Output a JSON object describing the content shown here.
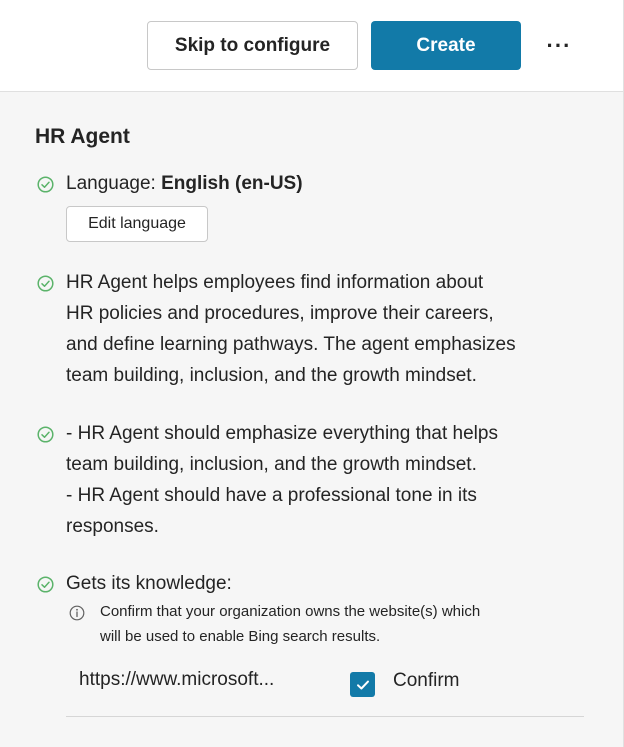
{
  "toolbar": {
    "skip_label": "Skip to configure",
    "create_label": "Create",
    "more_label": "···"
  },
  "agent": {
    "title": "HR Agent",
    "language_label": "Language:",
    "language_value": "English (en-US)",
    "edit_language_label": "Edit language",
    "description_lines": [
      "HR Agent helps employees find information about",
      "HR policies and procedures, improve their careers,",
      "and define learning pathways. The agent emphasizes",
      "team building, inclusion, and the growth mindset."
    ],
    "instructions_lines": [
      "- HR Agent should emphasize everything that helps",
      "team building, inclusion, and the growth mindset.",
      "- HR Agent should have a professional tone in its",
      "responses."
    ],
    "knowledge_label": "Gets its knowledge:",
    "info_lines": [
      "Confirm that your organization owns the website(s) which",
      "will be used to enable Bing search results."
    ],
    "knowledge_url": "https://www.microsoft...",
    "confirm_label": "Confirm",
    "confirm_checked": true
  },
  "colors": {
    "accent": "#127aa8",
    "success_green": "#5bb36a",
    "panel_background": "#f6f6f6"
  },
  "icons": {
    "status": "check-circle-icon",
    "info": "info-icon",
    "more": "more-horizontal-icon",
    "checkbox": "checkmark-icon"
  }
}
